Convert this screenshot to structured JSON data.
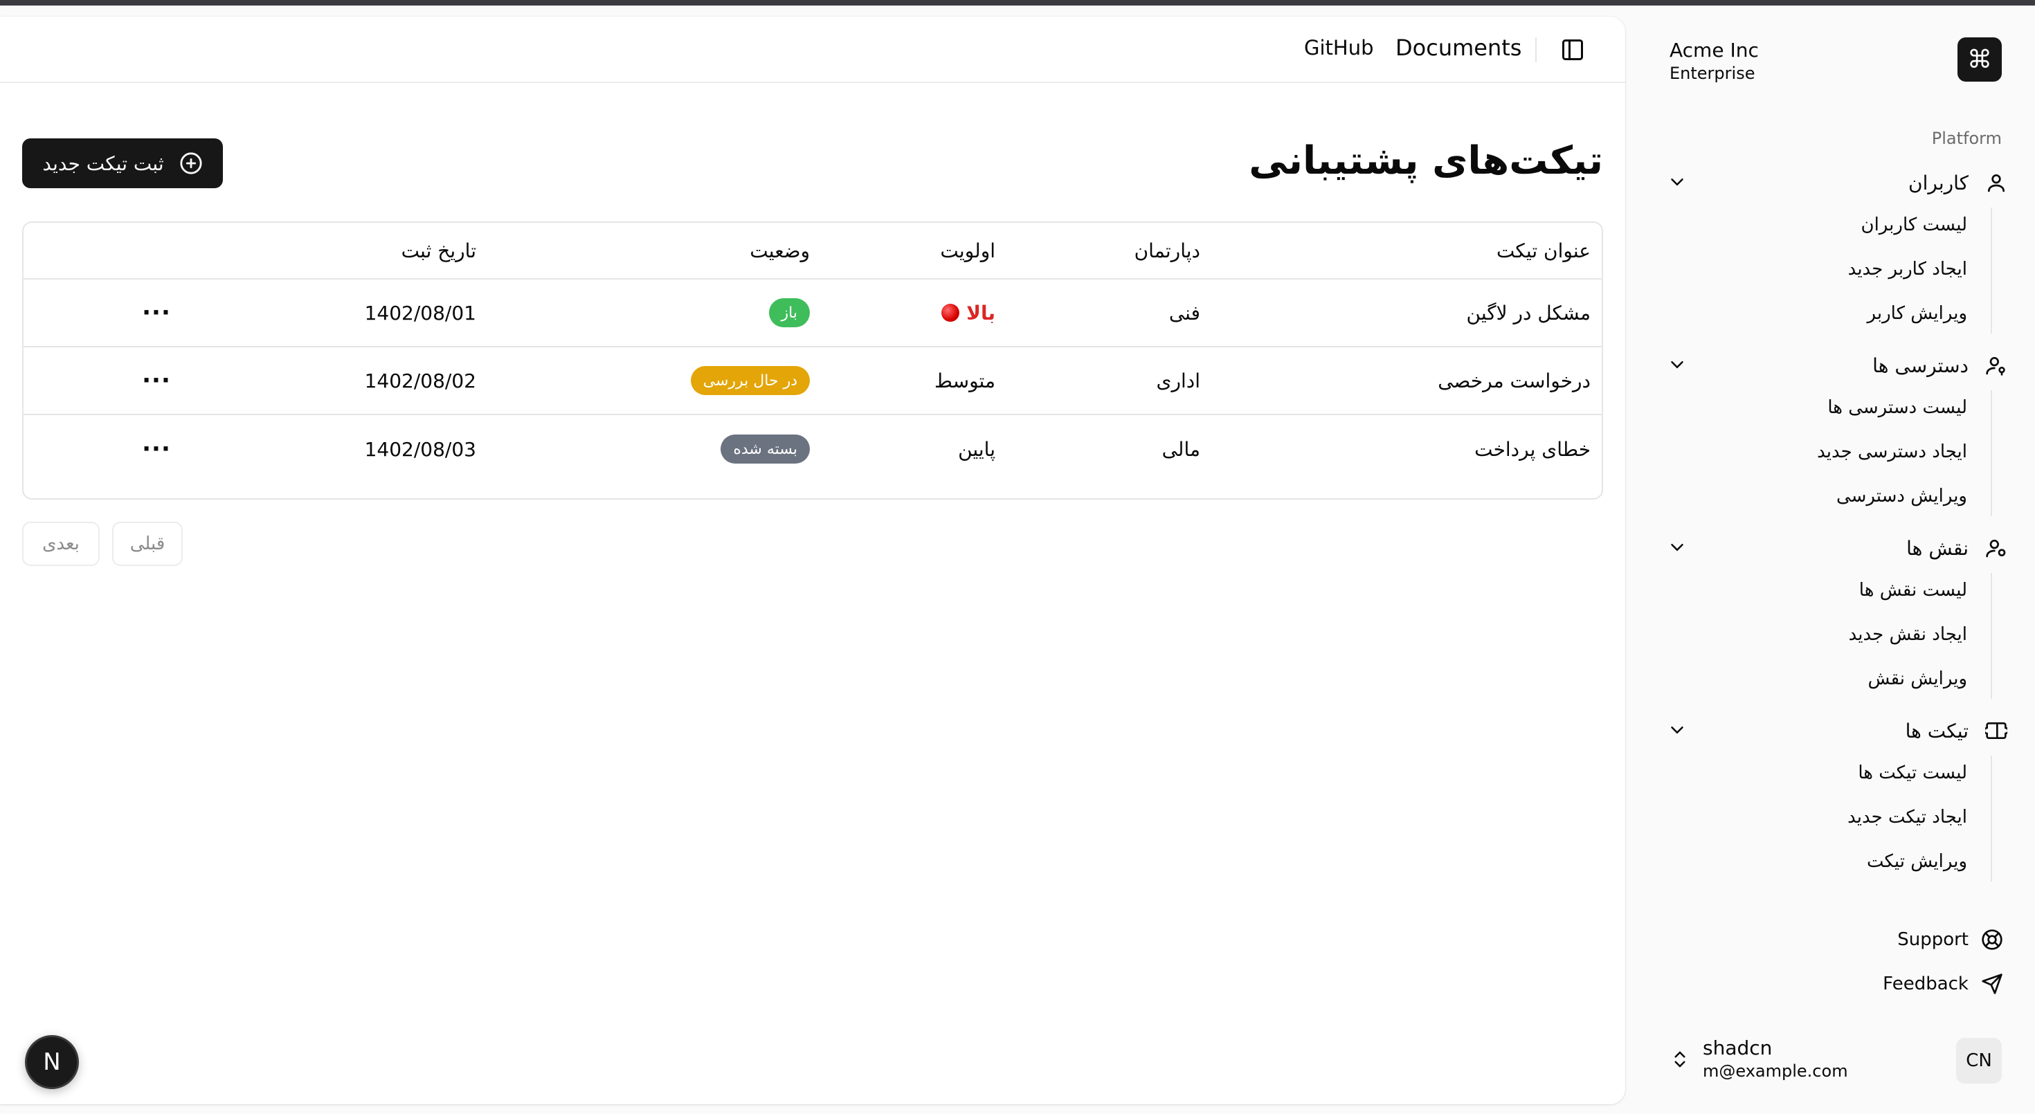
{
  "header": {
    "github_label": "GitHub",
    "documents_label": "Documents"
  },
  "page": {
    "title": "تیکت‌های پشتیبانی",
    "new_ticket_label": "ثبت تیکت جدید"
  },
  "table": {
    "columns": {
      "title": "عنوان تیکت",
      "department": "دپارتمان",
      "priority": "اولویت",
      "status": "وضعیت",
      "date": "تاریخ ثبت"
    },
    "rows": [
      {
        "title": "مشکل در لاگین",
        "department": "فنی",
        "priority": "بالا",
        "status": "باز",
        "date": "1402/08/01",
        "menu": "···"
      },
      {
        "title": "درخواست مرخصی",
        "department": "اداری",
        "priority": "متوسط",
        "status": "در حال بررسی",
        "date": "1402/08/02",
        "menu": "···"
      },
      {
        "title": "خطای پرداخت",
        "department": "مالی",
        "priority": "پایین",
        "status": "بسته شده",
        "date": "1402/08/03",
        "menu": "···"
      }
    ]
  },
  "pagination": {
    "next_label": "بعدی",
    "prev_label": "قبلی"
  },
  "dev_badge": "N",
  "sidebar": {
    "team_name": "Acme Inc",
    "team_plan": "Enterprise",
    "team_logo": "⌘",
    "group_label": "Platform",
    "groups": [
      {
        "label": "کاربران",
        "icon": "user-icon",
        "items": [
          "لیست کاربران",
          "ایجاد کاربر جدید",
          "ویرایش کاربر"
        ]
      },
      {
        "label": "دسترسی ها",
        "icon": "user-key-icon",
        "items": [
          "لیست دسترسی ها",
          "ایجاد دسترسی جدید",
          "ویرایش دسترسی"
        ]
      },
      {
        "label": "نقش ها",
        "icon": "user-cog-icon",
        "items": [
          "لیست نقش ها",
          "ایجاد نقش جدید",
          "ویرایش نقش"
        ]
      },
      {
        "label": "تیکت ها",
        "icon": "ticket-icon",
        "items": [
          "لیست تیکت ها",
          "ایجاد تیکت جدید",
          "ویرایش تیکت"
        ]
      }
    ],
    "support_label": "Support",
    "feedback_label": "Feedback",
    "user": {
      "name": "shadcn",
      "email": "m@example.com",
      "initials": "CN"
    }
  },
  "colors": {
    "badge_open": "#3fbd5b",
    "badge_review": "#e3a508",
    "badge_closed": "#6b7280",
    "priority_high": "#dc2626",
    "primary": "#171717"
  }
}
